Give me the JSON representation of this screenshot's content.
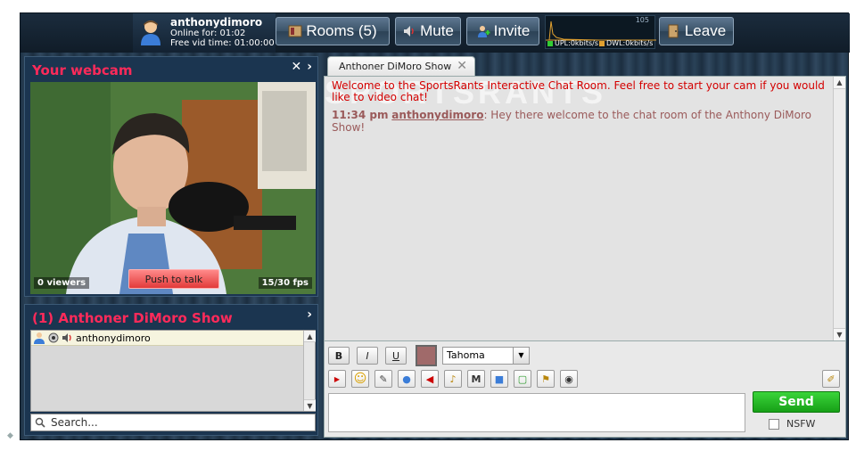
{
  "topbar": {
    "username": "anthonydimoro",
    "online_for": "Online for: 01:02",
    "free_vid_time": "Free vid time: 01:00:00",
    "rooms_label": "Rooms (5)",
    "mute_label": "Mute",
    "invite_label": "Invite",
    "leave_label": "Leave",
    "meter_value": "105",
    "upload_label": "UPL:0kbits/s",
    "download_label": "DWL:0kbits/s"
  },
  "webcam": {
    "title": "Your webcam",
    "viewers": "0 viewers",
    "push_to_talk": "Push to talk",
    "fps": "15/30 fps"
  },
  "room": {
    "title": "(1) Anthoner DiMoro Show",
    "users": [
      {
        "name": "anthonydimoro"
      }
    ],
    "search_placeholder": "Search..."
  },
  "chat": {
    "tab_label": "Anthoner DiMoro Show",
    "watermark": "SPORTSRANTS",
    "welcome": "Welcome to the SportsRants Interactive Chat Room. Feel free to start your cam if you would like to video chat!",
    "messages": [
      {
        "time": "11:34 pm",
        "user": "anthonydimoro",
        "text": ": Hey there welcome to the chat room of the Anthony DiMoro Show!"
      }
    ],
    "bold_label": "B",
    "italic_label": "I",
    "underline_label": "U",
    "font": "Tahoma",
    "send_label": "Send",
    "nsfw_label": "NSFW"
  },
  "colors": {
    "accent_title": "#ff2a5a",
    "welcome_text": "#d40000",
    "send_green": "#17a017",
    "text_color": "#a06a6a"
  }
}
